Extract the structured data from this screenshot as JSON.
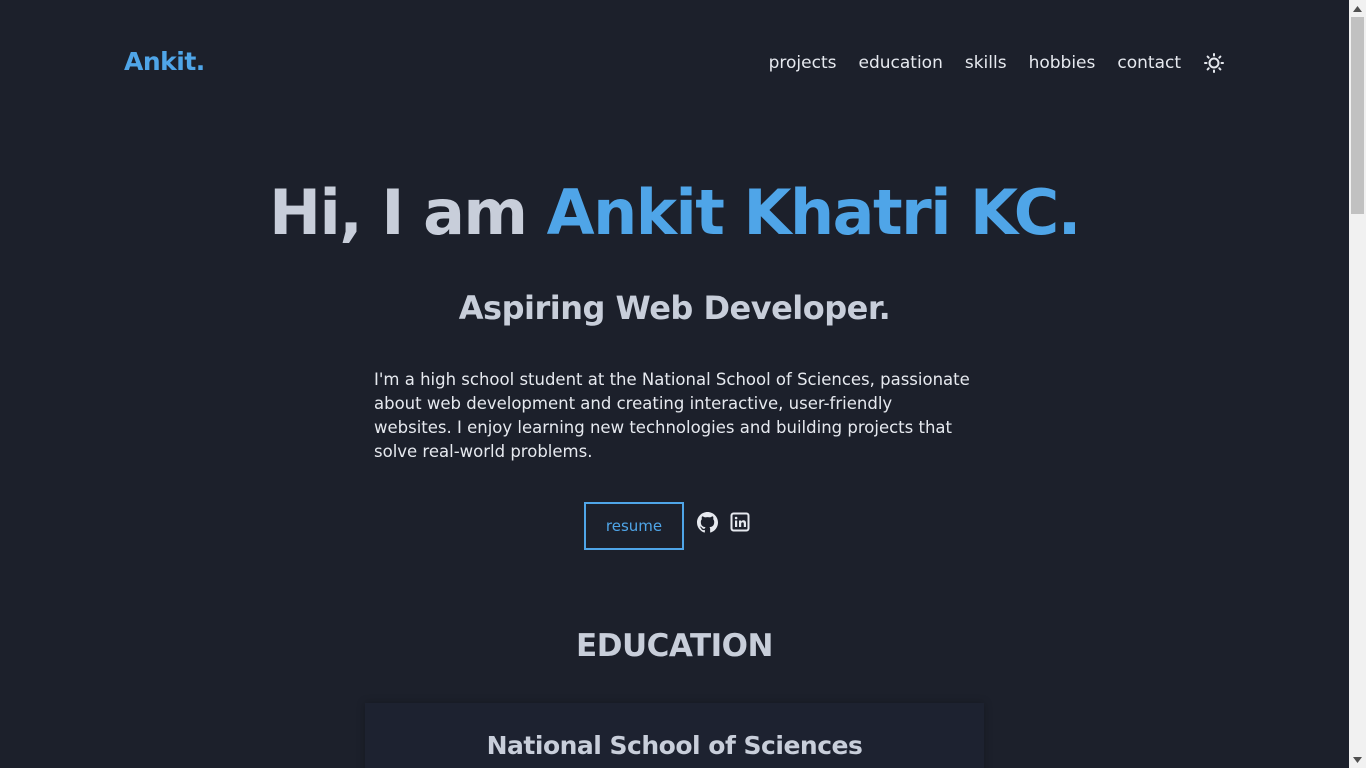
{
  "header": {
    "logo": "Ankit.",
    "nav": [
      {
        "label": "projects"
      },
      {
        "label": "education"
      },
      {
        "label": "skills"
      },
      {
        "label": "hobbies"
      },
      {
        "label": "contact"
      }
    ],
    "theme_icon": "sun-icon"
  },
  "hero": {
    "greeting": "Hi, I am ",
    "name": "Ankit Khatri KC.",
    "subtitle": "Aspiring Web Developer.",
    "description": "I'm a high school student at the National School of Sciences, passionate about web development and creating interactive, user-friendly websites. I enjoy learning new technologies and building projects that solve real-world problems.",
    "resume_label": "resume",
    "social_icons": [
      "github-icon",
      "linkedin-icon"
    ]
  },
  "education": {
    "title": "EDUCATION",
    "cards": [
      {
        "school": "National School of Sciences"
      }
    ]
  },
  "colors": {
    "background": "#1c202b",
    "accent": "#4fa5e8",
    "text": "#c8ceda"
  }
}
